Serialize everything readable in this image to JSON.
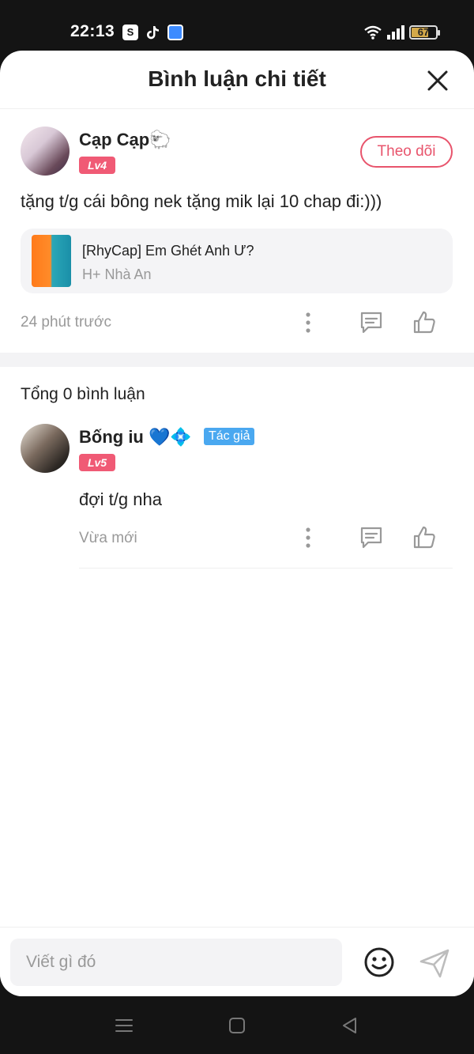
{
  "status_bar": {
    "time": "22:13",
    "battery": "67",
    "battery_fraction": 0.67,
    "apps": [
      "shop-icon",
      "tiktok-icon",
      "blue-app-icon"
    ]
  },
  "sheet": {
    "title": "Bình luận chi tiết"
  },
  "parent_comment": {
    "username": "Cạp Cạp🐑",
    "level": "Lv4",
    "follow_label": "Theo dõi",
    "text": "tặng t/g cái bông nek tặng mik lại 10 chap đi:)))",
    "reference": {
      "title": "[RhyCap] Em Ghét Anh Ư?",
      "author": "H+ Nhà An"
    },
    "time": "24 phút trước"
  },
  "replies_section": {
    "total_label": "Tổng 0 bình luận"
  },
  "reply": {
    "username": "Bống iu 💙💠",
    "author_tag": "Tác giả",
    "level": "Lv5",
    "text": "đợi t/g nha",
    "time": "Vừa mới"
  },
  "input": {
    "placeholder": "Viết gì đó"
  },
  "colors": {
    "accent": "#e8546c",
    "level_badge": "#f05a75",
    "author_tag": "#4aa8f0"
  }
}
